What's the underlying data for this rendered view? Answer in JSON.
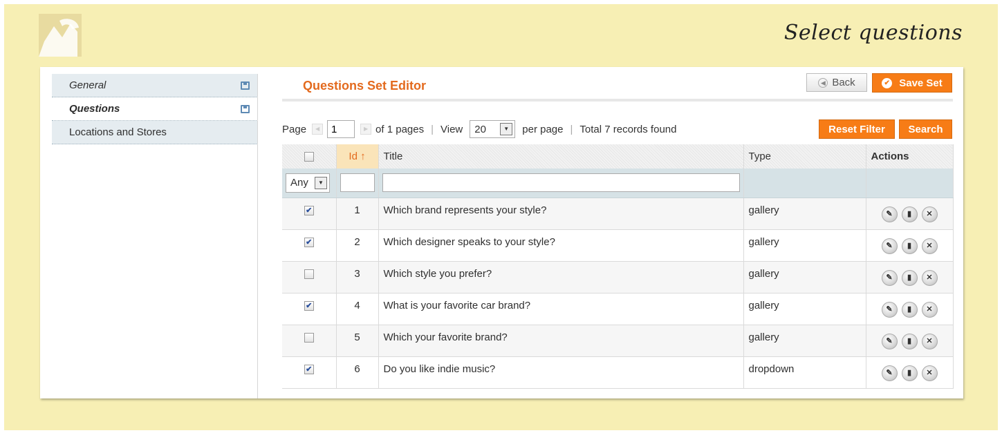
{
  "headline": "Select questions",
  "sidebar": {
    "items": [
      {
        "label": "General",
        "icon": "save-icon"
      },
      {
        "label": "Questions",
        "icon": "save-icon"
      },
      {
        "label": "Locations and Stores"
      }
    ]
  },
  "editor": {
    "title": "Questions Set Editor",
    "back_label": "Back",
    "save_label": "Save Set"
  },
  "pager": {
    "page_label": "Page",
    "page_value": "1",
    "of_pages": "of 1 pages",
    "view_label": "View",
    "per_page_value": "20",
    "per_page_label": "per page",
    "total": "Total 7 records found",
    "reset_label": "Reset Filter",
    "search_label": "Search"
  },
  "grid": {
    "columns": {
      "id": "Id",
      "title": "Title",
      "type": "Type",
      "actions": "Actions"
    },
    "filter_any": "Any",
    "rows": [
      {
        "checked": true,
        "id": "1",
        "title": "Which brand represents your style?",
        "type": "gallery"
      },
      {
        "checked": true,
        "id": "2",
        "title": "Which designer speaks to your style?",
        "type": "gallery"
      },
      {
        "checked": false,
        "id": "3",
        "title": "Which style you prefer?",
        "type": "gallery"
      },
      {
        "checked": true,
        "id": "4",
        "title": "What is your favorite car brand?",
        "type": "gallery"
      },
      {
        "checked": false,
        "id": "5",
        "title": "Which your favorite brand?",
        "type": "gallery"
      },
      {
        "checked": true,
        "id": "6",
        "title": "Do you like indie music?",
        "type": "dropdown"
      }
    ],
    "row_actions": [
      "edit-icon",
      "stats-icon",
      "delete-icon"
    ]
  },
  "colors": {
    "accent": "#f77c16",
    "title": "#e36a1e",
    "background": "#f7efb4"
  }
}
